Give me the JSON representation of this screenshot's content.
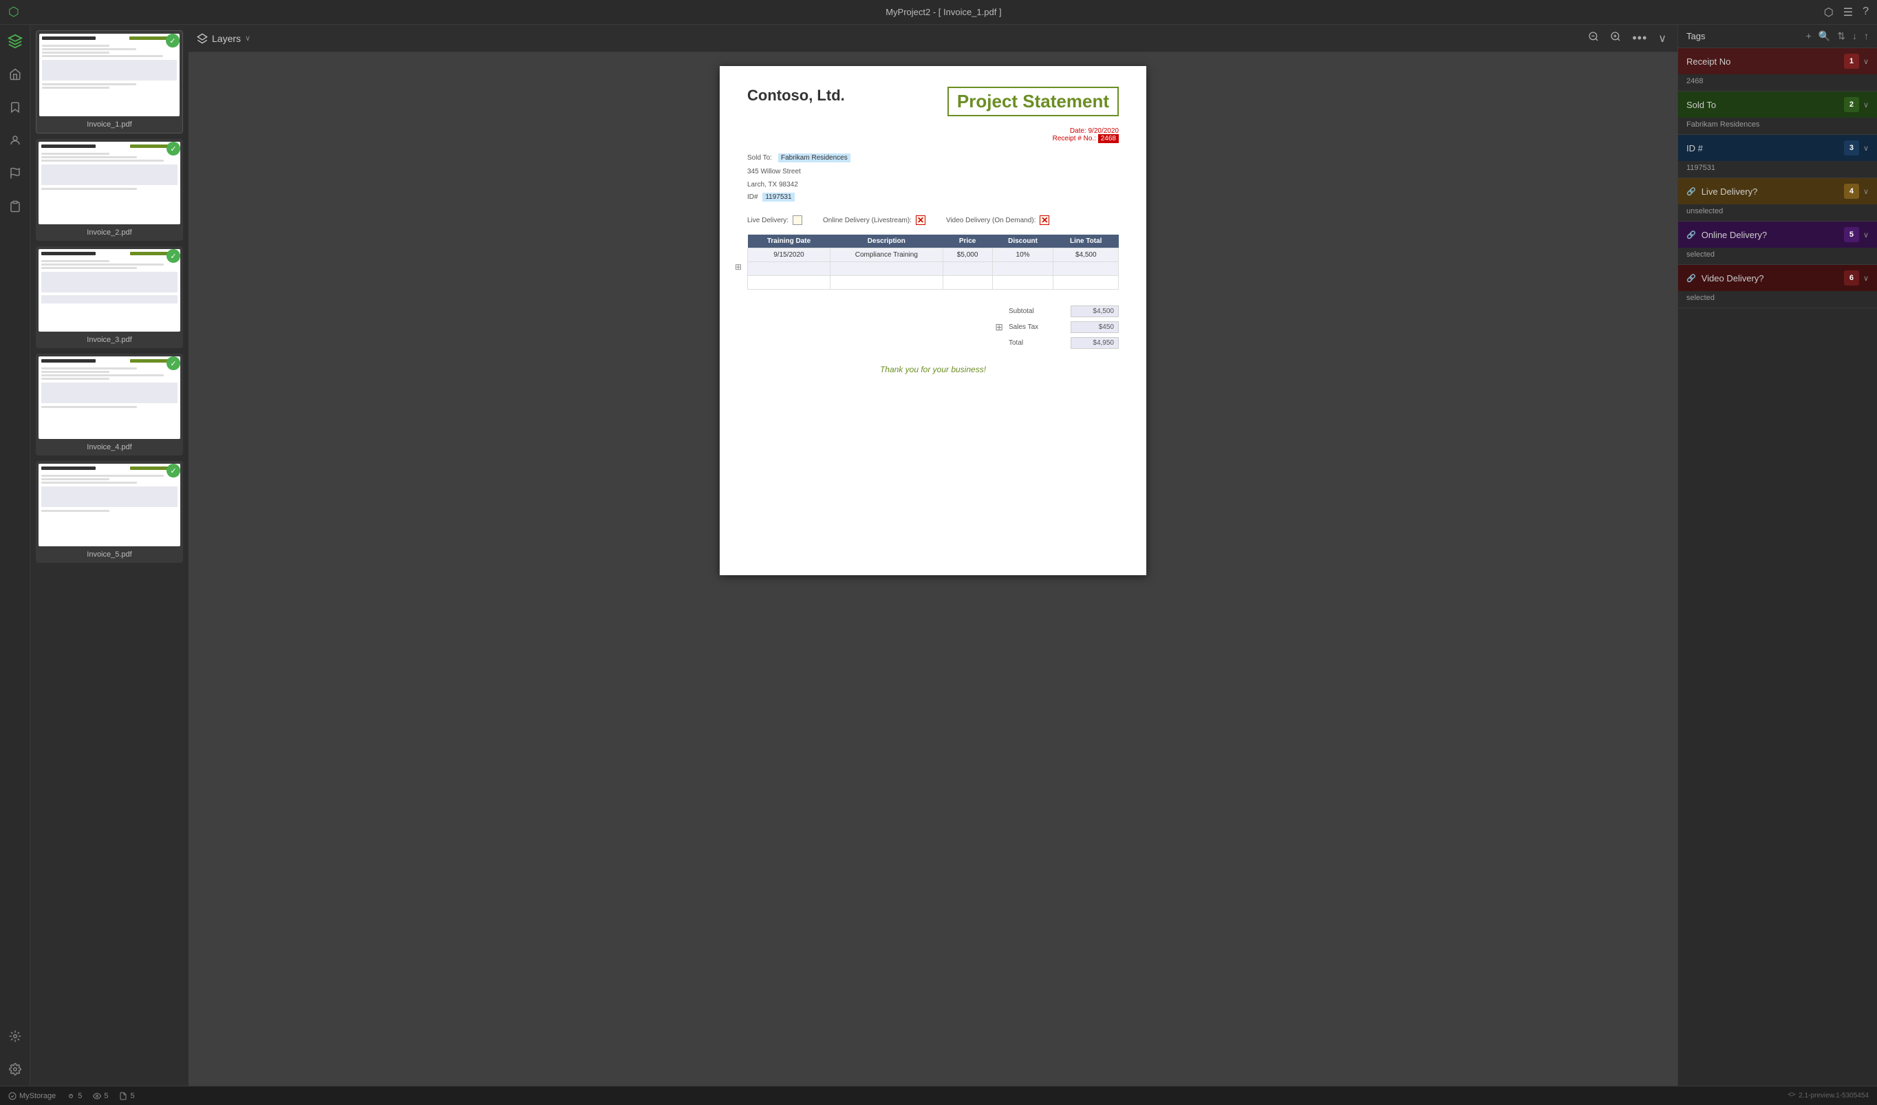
{
  "app": {
    "title": "MyProject2 - [ Invoice_1.pdf ]",
    "version": "2.1-preview.1-5305454"
  },
  "topbar": {
    "title": "MyProject2 - [ Invoice_1.pdf ]",
    "icons": [
      "share",
      "layout",
      "help"
    ]
  },
  "toolbar": {
    "layers_label": "Layers",
    "zoom_out": "−",
    "zoom_in": "+",
    "more": "•••",
    "chevron": "∨"
  },
  "thumbnails": [
    {
      "label": "Invoice_1.pdf",
      "active": true,
      "badge": true
    },
    {
      "label": "Invoice_2.pdf",
      "active": false,
      "badge": true
    },
    {
      "label": "Invoice_3.pdf",
      "active": false,
      "badge": true
    },
    {
      "label": "Invoice_4.pdf",
      "active": false,
      "badge": true
    },
    {
      "label": "Invoice_5.pdf",
      "active": false,
      "badge": true
    }
  ],
  "invoice": {
    "company": "Contoso, Ltd.",
    "title": "Project Statement",
    "date_label": "Date:",
    "date_value": "9/20/2020",
    "receipt_label": "Receipt # No.:",
    "receipt_value": "2468",
    "sold_to_label": "Sold To:",
    "sold_to_name": "Fabrikam Residences",
    "address1": "345 Willow Street",
    "address2": "Larch, TX 98342",
    "id_label": "ID#",
    "id_value": "1197531",
    "live_delivery_label": "Live Delivery:",
    "live_delivery_checked": false,
    "online_delivery_label": "Online Delivery (Livestream):",
    "online_delivery_checked": true,
    "video_delivery_label": "Video Delivery (On Demand):",
    "video_delivery_checked": true,
    "table": {
      "headers": [
        "Training Date",
        "Description",
        "Price",
        "Discount",
        "Line Total"
      ],
      "rows": [
        {
          "date": "9/15/2020",
          "description": "Compliance Training",
          "price": "$5,000",
          "discount": "10%",
          "total": "$4,500"
        },
        {
          "date": "",
          "description": "",
          "price": "",
          "discount": "",
          "total": ""
        },
        {
          "date": "",
          "description": "",
          "price": "",
          "discount": "",
          "total": ""
        }
      ]
    },
    "subtotal_label": "Subtotal",
    "subtotal_value": "$4,500",
    "sales_tax_label": "Sales Tax",
    "sales_tax_value": "$450",
    "total_label": "Total",
    "total_value": "$4,950",
    "thank_you": "Thank you for your business!"
  },
  "tags": {
    "panel_title": "Tags",
    "items": [
      {
        "id": 1,
        "label": "Receipt No",
        "value": "2468",
        "color_class": "receipt",
        "has_link": false
      },
      {
        "id": 2,
        "label": "Sold To",
        "value": "Fabrikam Residences",
        "color_class": "soldto",
        "has_link": false
      },
      {
        "id": 3,
        "label": "ID #",
        "value": "1197531",
        "color_class": "id",
        "has_link": false
      },
      {
        "id": 4,
        "label": "Live Delivery?",
        "value": "unselected",
        "color_class": "live",
        "has_link": true
      },
      {
        "id": 5,
        "label": "Online Delivery?",
        "value": "selected",
        "color_class": "online",
        "has_link": true
      },
      {
        "id": 6,
        "label": "Video Delivery?",
        "value": "selected",
        "color_class": "video",
        "has_link": true
      }
    ]
  },
  "statusbar": {
    "storage_label": "MyStorage",
    "count1": "5",
    "count2": "5",
    "count3": "5",
    "version": "2.1-preview.1-5305454"
  }
}
